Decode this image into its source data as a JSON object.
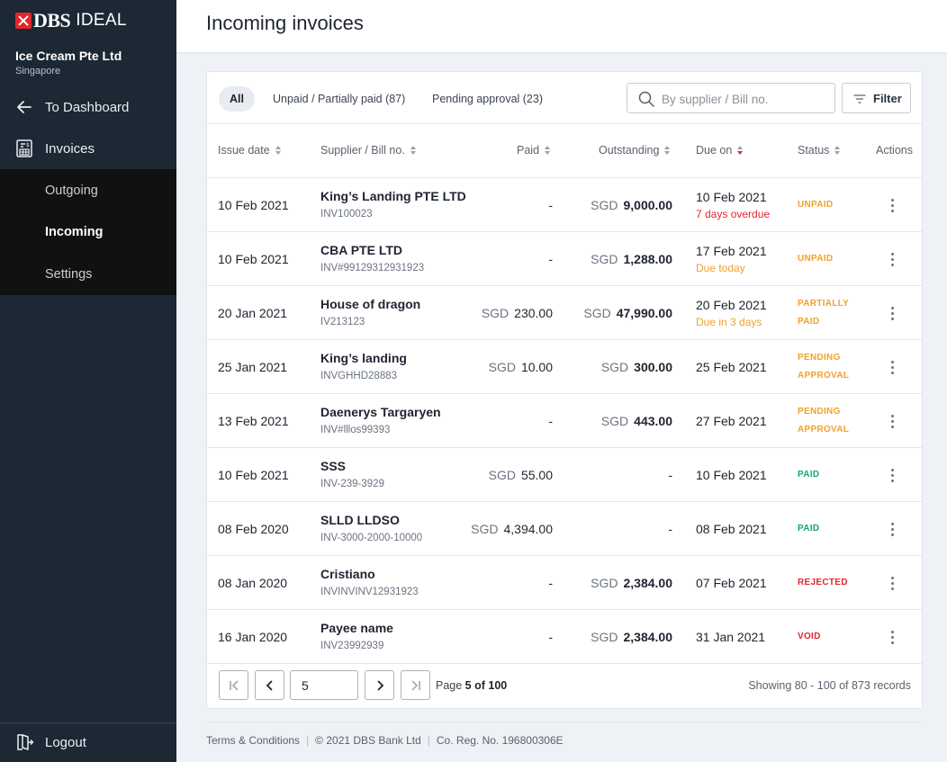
{
  "brand": {
    "name": "DBS",
    "product": "IDEAL"
  },
  "account": {
    "company": "Ice Cream Pte Ltd",
    "country": "Singapore"
  },
  "nav": {
    "back_label": "To Dashboard",
    "invoices_label": "Invoices",
    "sub": [
      {
        "label": "Outgoing",
        "active": false
      },
      {
        "label": "Incoming",
        "active": true
      },
      {
        "label": "Settings",
        "active": false
      }
    ],
    "logout_label": "Logout"
  },
  "page": {
    "title": "Incoming invoices"
  },
  "tabs": [
    {
      "label": "All",
      "active": true
    },
    {
      "label": "Unpaid / Partially paid (87)",
      "active": false
    },
    {
      "label": "Pending approval (23)",
      "active": false
    }
  ],
  "search": {
    "placeholder": "By supplier / Bill no.",
    "value": ""
  },
  "filter": {
    "label": "Filter"
  },
  "table": {
    "columns": [
      "Issue date",
      "Supplier / Bill no.",
      "Paid",
      "Outstanding",
      "Due on",
      "Status",
      "Actions"
    ],
    "sorted_column": "Due on",
    "rows": [
      {
        "issue_date": "10 Feb 2021",
        "supplier": "King’s Landing PTE LTD",
        "bill_no": "INV100023",
        "paid_currency": "",
        "paid": "-",
        "out_currency": "SGD",
        "outstanding": "9,000.00",
        "due_on": "10 Feb 2021",
        "due_note": "7 days overdue",
        "due_note_color": "#e3262d",
        "status": [
          "UNPAID"
        ],
        "status_color": "#f0a12c"
      },
      {
        "issue_date": "10 Feb 2021",
        "supplier": "CBA PTE LTD",
        "bill_no": "INV#99129312931923",
        "paid_currency": "",
        "paid": "-",
        "out_currency": "SGD",
        "outstanding": "1,288.00",
        "due_on": "17 Feb 2021",
        "due_note": "Due today",
        "due_note_color": "#f0a12c",
        "status": [
          "UNPAID"
        ],
        "status_color": "#f0a12c"
      },
      {
        "issue_date": "20 Jan 2021",
        "supplier": "House of dragon",
        "bill_no": "IV213123",
        "paid_currency": "SGD",
        "paid": "230.00",
        "out_currency": "SGD",
        "outstanding": "47,990.00",
        "due_on": "20 Feb 2021",
        "due_note": "Due in 3 days",
        "due_note_color": "#f0a12c",
        "status": [
          "PARTIALLY",
          "PAID"
        ],
        "status_color": "#f0a12c"
      },
      {
        "issue_date": "25 Jan 2021",
        "supplier": "King’s landing",
        "bill_no": "INVGHHD28883",
        "paid_currency": "SGD",
        "paid": "10.00",
        "out_currency": "SGD",
        "outstanding": "300.00",
        "due_on": "25 Feb 2021",
        "due_note": "",
        "due_note_color": "",
        "status": [
          "PENDING",
          "APPROVAL"
        ],
        "status_color": "#f0a12c"
      },
      {
        "issue_date": "13 Feb 2021",
        "supplier": "Daenerys Targaryen",
        "bill_no": "INV#lllos99393",
        "paid_currency": "",
        "paid": "-",
        "out_currency": "SGD",
        "outstanding": "443.00",
        "due_on": "27 Feb 2021",
        "due_note": "",
        "due_note_color": "",
        "status": [
          "PENDING",
          "APPROVAL"
        ],
        "status_color": "#f0a12c"
      },
      {
        "issue_date": "10 Feb 2021",
        "supplier": "SSS",
        "bill_no": "INV-239-3929",
        "paid_currency": "SGD",
        "paid": "55.00",
        "out_currency": "",
        "outstanding": "-",
        "due_on": "10 Feb 2021",
        "due_note": "",
        "due_note_color": "",
        "status": [
          "PAID"
        ],
        "status_color": "#1aa37a"
      },
      {
        "issue_date": "08 Feb 2020",
        "supplier": "SLLD LLDSO",
        "bill_no": "INV-3000-2000-10000",
        "paid_currency": "SGD",
        "paid": "4,394.00",
        "out_currency": "",
        "outstanding": "-",
        "due_on": "08 Feb 2021",
        "due_note": "",
        "due_note_color": "",
        "status": [
          "PAID"
        ],
        "status_color": "#1aa37a"
      },
      {
        "issue_date": "08 Jan 2020",
        "supplier": "Cristiano",
        "bill_no": "INVINVINV12931923",
        "paid_currency": "",
        "paid": "-",
        "out_currency": "SGD",
        "outstanding": "2,384.00",
        "due_on": "07 Feb 2021",
        "due_note": "",
        "due_note_color": "",
        "status": [
          "REJECTED"
        ],
        "status_color": "#e3262d"
      },
      {
        "issue_date": "16 Jan 2020",
        "supplier": "Payee name",
        "bill_no": "INV23992939",
        "paid_currency": "",
        "paid": "-",
        "out_currency": "SGD",
        "outstanding": "2,384.00",
        "due_on": "31 Jan 2021",
        "due_note": "",
        "due_note_color": "",
        "status": [
          "VOID"
        ],
        "status_color": "#e3262d"
      }
    ]
  },
  "pagination": {
    "current": "5",
    "page_prefix": "Page ",
    "page_text": "5 of 100",
    "records": "Showing 80 - 100 of 873 records"
  },
  "footer": {
    "terms": "Terms & Conditions",
    "copyright": "© 2021 DBS Bank Ltd",
    "reg": "Co. Reg. No. 196800306E"
  }
}
